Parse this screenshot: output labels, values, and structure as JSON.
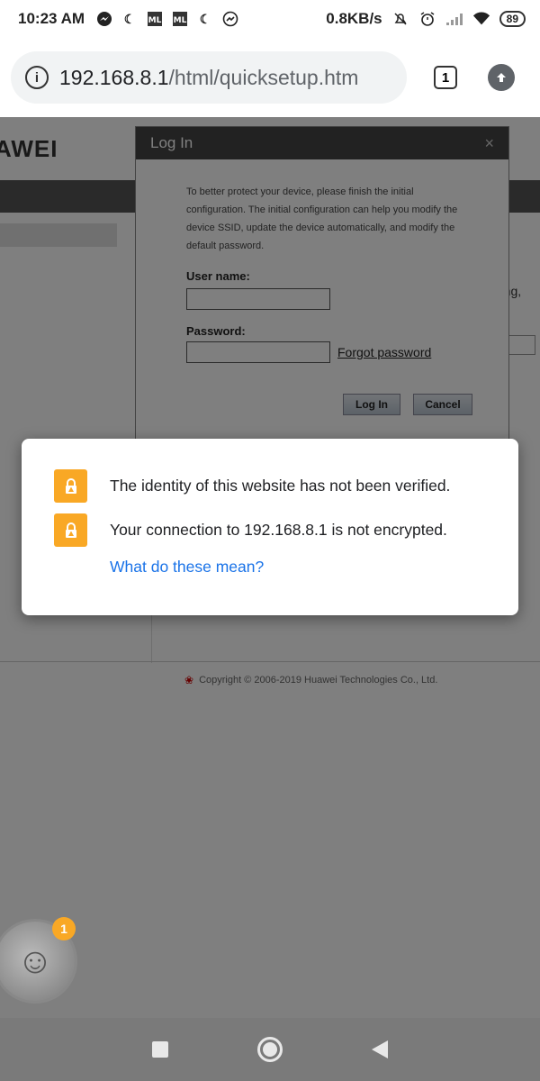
{
  "status_bar": {
    "time": "10:23 AM",
    "speed": "0.8KB/s",
    "battery": "89"
  },
  "browser": {
    "url_host": "192.168.8.1",
    "url_path": "/html/quicksetup.htm",
    "tab_count": "1"
  },
  "page": {
    "logo": "AWEI",
    "right_text_line1": "tring,",
    "right_text_line2": "N).",
    "copyright": "Copyright © 2006-2019 Huawei Technologies Co., Ltd."
  },
  "login": {
    "title": "Log In",
    "close": "×",
    "description": "To better protect your device, please finish the initial configuration. The initial configuration can help you modify the device SSID, update the device automatically, and modify the default password.",
    "username_label": "User name:",
    "password_label": "Password:",
    "forgot": "Forgot password",
    "login_button": "Log In",
    "cancel_button": "Cancel"
  },
  "popup": {
    "identity_message": "The identity of this website has not been verified.",
    "connection_message": "Your connection to 192.168.8.1 is not encrypted.",
    "link": "What do these mean?"
  },
  "chat_head": {
    "badge": "1"
  },
  "colors": {
    "warning": "#f9a825",
    "link": "#1a73e8"
  }
}
